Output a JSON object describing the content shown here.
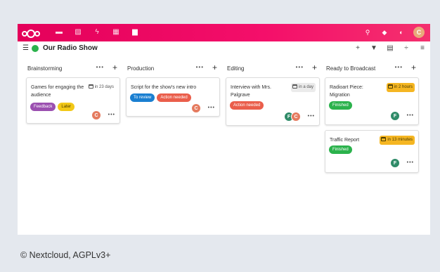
{
  "topbar": {
    "apps": [
      {
        "icon": "files-icon",
        "glyph": "▬"
      },
      {
        "icon": "photos-icon",
        "glyph": "▨"
      },
      {
        "icon": "activity-icon",
        "glyph": "ϟ"
      },
      {
        "icon": "calendar-icon",
        "glyph": "▦"
      },
      {
        "icon": "deck-icon",
        "glyph": "▆"
      }
    ],
    "user_initial": "C"
  },
  "board": {
    "title": "Our Radio Show",
    "color": "#2bb24c"
  },
  "stacks": [
    {
      "title": "Brainstorming",
      "cards": [
        {
          "title": "Games for engaging the audience",
          "due": "in 23 days",
          "labels": [
            "Feedback",
            "Later"
          ],
          "avatars": [
            "C"
          ]
        }
      ]
    },
    {
      "title": "Production",
      "cards": [
        {
          "title": "Script for the show's new intro",
          "due": "",
          "labels": [
            "To review",
            "Action needed"
          ],
          "avatars": [
            "C"
          ]
        }
      ]
    },
    {
      "title": "Editing",
      "cards": [
        {
          "title": "Interview with Mrs. Palgrave",
          "due": "in a day",
          "labels": [
            "Action needed"
          ],
          "avatars": [
            "F",
            "C"
          ]
        }
      ]
    },
    {
      "title": "Ready to Broadcast",
      "cards": [
        {
          "title": "Radioart Piece: Migration",
          "due": "in 2 hours",
          "labels": [
            "Finished"
          ],
          "avatars": [
            "F"
          ]
        },
        {
          "title": "Traffic Report",
          "due": "in 13 minutes",
          "labels": [
            "Finished"
          ],
          "avatars": [
            "F"
          ]
        }
      ]
    }
  ],
  "label_colors": {
    "Feedback": "#9b4fb0",
    "Later": "#f2c818",
    "To review": "#1a7fd1",
    "Action needed": "#ea5e4b",
    "Finished": "#2bb24c"
  },
  "avatar_colors": {
    "C": "#e57b5f",
    "F": "#2f8b68"
  },
  "more_glyph": "•••",
  "add_glyph": "+",
  "copyright": "© Nextcloud, AGPLv3+"
}
